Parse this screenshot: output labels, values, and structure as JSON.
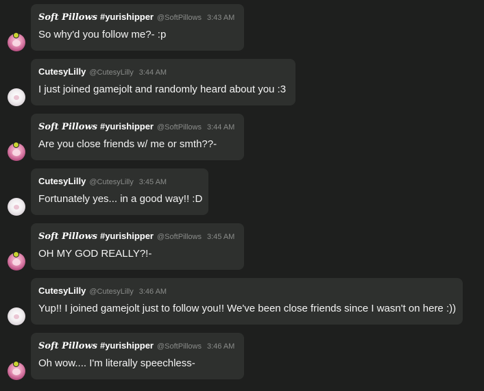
{
  "colors": {
    "background": "#1e1f1e",
    "bubble": "#2e302e",
    "text": "#f4f4f4",
    "meta": "#8a8c8a",
    "badge": "#c9d433"
  },
  "messages": [
    {
      "author": "Soft Pillows #yurishipper",
      "author_script": "Soft Pillows",
      "author_tag": "#yurishipper",
      "handle": "@SoftPillows",
      "time": "3:43 AM",
      "text": "So why'd you follow me?- :p",
      "avatar_icon": "pink-anime-avatar-icon"
    },
    {
      "author": "CutesyLilly",
      "handle": "@CutesyLilly",
      "time": "3:44 AM",
      "text": "I just joined gamejolt and randomly heard about you :3",
      "avatar_icon": "white-anime-avatar-icon"
    },
    {
      "author_script": "Soft Pillows",
      "author_tag": "#yurishipper",
      "handle": "@SoftPillows",
      "time": "3:44 AM",
      "text": "Are you close friends w/ me or smth??-",
      "avatar_icon": "pink-anime-avatar-icon"
    },
    {
      "author": "CutesyLilly",
      "handle": "@CutesyLilly",
      "time": "3:45 AM",
      "text": "Fortunately yes... in a good way!! :D",
      "avatar_icon": "white-anime-avatar-icon"
    },
    {
      "author_script": "Soft Pillows",
      "author_tag": "#yurishipper",
      "handle": "@SoftPillows",
      "time": "3:45 AM",
      "text": "OH MY GOD REALLY?!-",
      "avatar_icon": "pink-anime-avatar-icon"
    },
    {
      "author": "CutesyLilly",
      "handle": "@CutesyLilly",
      "time": "3:46 AM",
      "text": "Yup!! I joined gamejolt just to follow you!! We've been close friends since I wasn't on here :))",
      "avatar_icon": "white-anime-avatar-icon"
    },
    {
      "author_script": "Soft Pillows",
      "author_tag": "#yurishipper",
      "handle": "@SoftPillows",
      "time": "3:46 AM",
      "text": "Oh wow.... I'm literally speechless-",
      "avatar_icon": "pink-anime-avatar-icon"
    }
  ]
}
